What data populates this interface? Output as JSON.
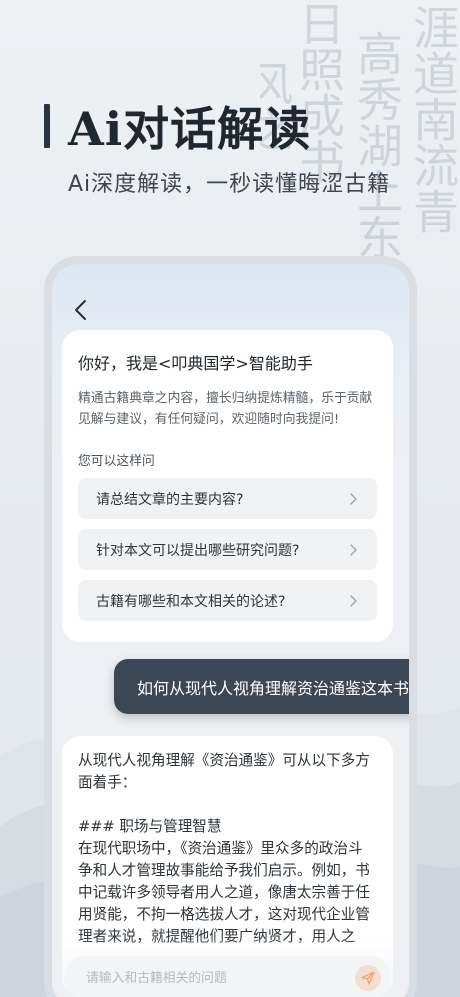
{
  "hero": {
    "title": "Ai对话解读",
    "subtitle": "Ai深度解读，一秒读懂晦涩古籍"
  },
  "colors": {
    "accent_dark": "#3c4756",
    "background": "#e7ebef",
    "send_icon": "#e9a77a"
  },
  "chat": {
    "back_icon": "chevron-left-icon",
    "greeting": "你好，我是<叩典国学>智能助手",
    "intro": "精通古籍典章之内容，擅长归纳提炼精髓，乐于贡献见解与建议，有任何疑问，欢迎随时向我提问!",
    "hint": "您可以这样问",
    "suggestions": [
      {
        "label": "请总结文章的主要内容?"
      },
      {
        "label": "针对本文可以提出哪些研究问题?"
      },
      {
        "label": "古籍有哪些和本文相关的论述?"
      }
    ],
    "user_message": "如何从现代人视角理解资治通鉴这本书",
    "answer": "从现代人视角理解《资治通鉴》可从以下多方面着手：\n\n### 职场与管理智慧\n在现代职场中，《资治通鉴》里众多的政治斗争和人才管理故事能给予我们启示。例如，书中记载许多领导者用人之道，像唐太宗善于任用贤能，不拘一格选拔人才，这对现代企业管理者来说，就提醒他们要广纳贤才，用人之",
    "input_placeholder": "请输入和古籍相关的问题",
    "send_icon": "send-icon"
  }
}
